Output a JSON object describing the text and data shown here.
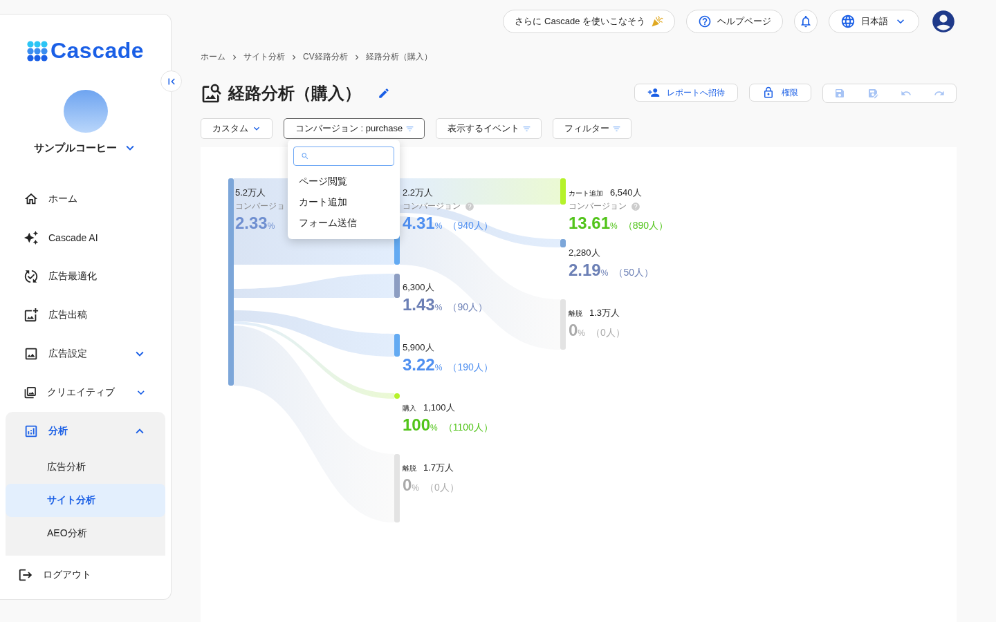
{
  "sidebar": {
    "logo": "Cascade",
    "workspace": "サンプルコーヒー",
    "items": [
      {
        "label": "ホーム",
        "selected": false
      },
      {
        "label": "Cascade AI",
        "selected": false
      },
      {
        "label": "広告最適化",
        "selected": false
      },
      {
        "label": "広告出稿",
        "selected": false
      },
      {
        "label": "広告設定",
        "selected": false,
        "expanded": false
      },
      {
        "label": "クリエイティブ",
        "selected": false,
        "expanded": false
      },
      {
        "label": "分析",
        "selected": true,
        "expanded": true,
        "children": [
          {
            "label": "広告分析",
            "selected": false
          },
          {
            "label": "サイト分析",
            "selected": true
          },
          {
            "label": "AEO分析",
            "selected": false
          }
        ]
      }
    ],
    "logout": "ログアウト"
  },
  "header": {
    "promo": "さらに Cascade を使いこなそう",
    "help": "ヘルプページ",
    "language": "日本語"
  },
  "breadcrumb": [
    "ホーム",
    "サイト分析",
    "CV経路分析",
    "経路分析（購入）"
  ],
  "title": "経路分析（購入）",
  "actions": {
    "invite": "レポートへ招待",
    "permission": "権限"
  },
  "filters": [
    {
      "label": "カスタム",
      "kind": "chevron",
      "open": false
    },
    {
      "label": "コンバージョン : purchase",
      "kind": "filter",
      "open": true
    },
    {
      "label": "表示するイベント",
      "kind": "filter",
      "open": false
    },
    {
      "label": "フィルター",
      "kind": "filter",
      "open": false
    }
  ],
  "dropdown": {
    "options": [
      "ページ閲覧",
      "カート追加",
      "フォーム送信"
    ]
  },
  "nodes": [
    {
      "count": "5.2万人",
      "conversion": "コンバージョ",
      "pct": "2.33",
      "unit": "%",
      "color": "#6f8fd0"
    },
    {
      "count": "2.2万人",
      "conversion": "コンバージョン",
      "help": true,
      "pct": "4.31",
      "unit": "%",
      "people": "（940人）",
      "color": "#4f8ff0"
    },
    {
      "count": "6,300人",
      "pct": "1.43",
      "unit": "%",
      "people": "（90人）",
      "color": "#6b7fb5"
    },
    {
      "count": "5,900人",
      "pct": "3.22",
      "unit": "%",
      "people": "（190人）",
      "color": "#4f8ff0"
    },
    {
      "tag": "購入",
      "count": "1,100人",
      "pct": "100",
      "unit": "%",
      "people": "（1100人）",
      "color": "#52c41a"
    },
    {
      "tag": "離脱",
      "count": "1.7万人",
      "pct": "0",
      "unit": "%",
      "people": "（0人）",
      "color": "#aaaaaa"
    },
    {
      "tag": "カート追加",
      "count": "6,540人",
      "conversion": "コンバージョン",
      "help": true,
      "pct": "13.61",
      "unit": "%",
      "people": "（890人）",
      "color": "#52c41a"
    },
    {
      "count": "2,280人",
      "pct": "2.19",
      "unit": "%",
      "people": "（50人）",
      "color": "#6b7fb5"
    },
    {
      "tag": "離脱",
      "count": "1.3万人",
      "pct": "0",
      "unit": "%",
      "people": "（0人）",
      "color": "#aaaaaa"
    }
  ]
}
